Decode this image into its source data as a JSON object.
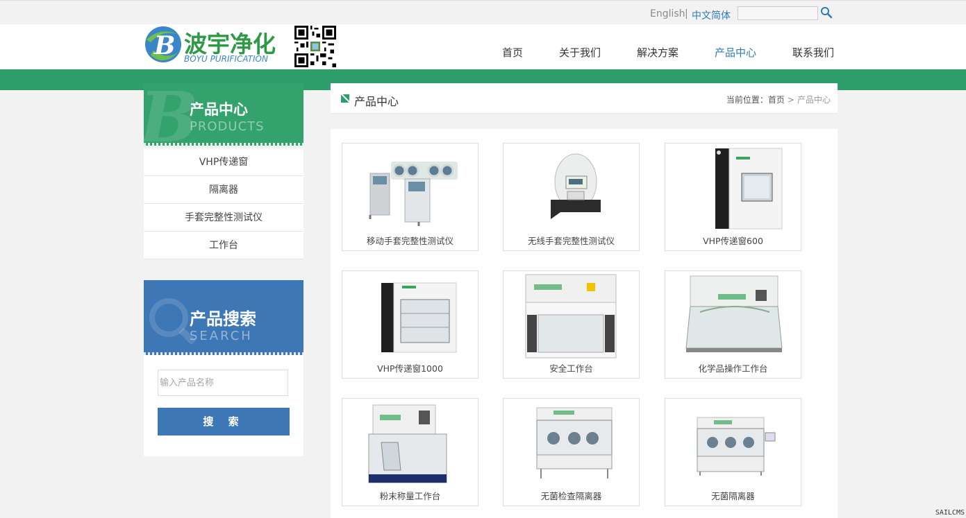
{
  "topbar": {
    "lang_en": "English",
    "lang_sep": "|",
    "lang_cn": "中文简体",
    "search_placeholder": ""
  },
  "logo": {
    "text_cn": "波宇净化",
    "text_en": "BOYU PURIFICATION"
  },
  "nav": [
    {
      "label": "首页"
    },
    {
      "label": "关于我们"
    },
    {
      "label": "解决方案"
    },
    {
      "label": "产品中心"
    },
    {
      "label": "联系我们"
    }
  ],
  "sidebar": {
    "products_title": "产品中心",
    "products_sub": "PRODUCTS",
    "categories": [
      {
        "label": "VHP传递窗"
      },
      {
        "label": "隔离器"
      },
      {
        "label": "手套完整性测试仪"
      },
      {
        "label": "工作台"
      }
    ],
    "search_title": "产品搜索",
    "search_sub": "SEARCH",
    "search_placeholder": "输入产品名称",
    "search_button": "搜 索"
  },
  "main": {
    "title": "产品中心",
    "breadcrumb": {
      "prefix": "当前位置：",
      "home": "首页",
      "arrow": ">",
      "current": "产品中心"
    },
    "products": [
      {
        "name": "移动手套完整性测试仪"
      },
      {
        "name": "无线手套完整性测试仪"
      },
      {
        "name": "VHP传递窗600"
      },
      {
        "name": "VHP传递窗1000"
      },
      {
        "name": "安全工作台"
      },
      {
        "name": "化学品操作工作台"
      },
      {
        "name": "粉末称量工作台"
      },
      {
        "name": "无菌检查隔离器"
      },
      {
        "name": "无菌隔离器"
      }
    ]
  },
  "footer_mark": "SAILCMS",
  "colors": {
    "green": "#2e9e6b",
    "blue": "#3e77b5",
    "link": "#2e7bb5"
  }
}
